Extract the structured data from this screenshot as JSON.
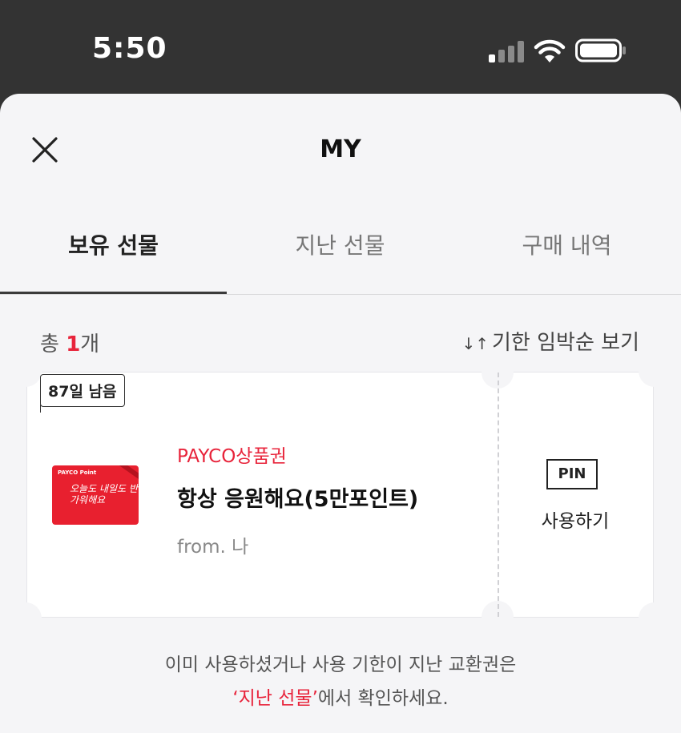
{
  "status_bar": {
    "time": "5:50",
    "icons": [
      "cellular-signal-icon",
      "wifi-icon",
      "battery-icon"
    ]
  },
  "header": {
    "title": "MY",
    "close_icon": "close-icon"
  },
  "tabs": [
    {
      "label": "보유 선물",
      "active": true
    },
    {
      "label": "지난 선물",
      "active": false
    },
    {
      "label": "구매 내역",
      "active": false
    }
  ],
  "summary": {
    "prefix": "총",
    "count": "1",
    "suffix": "개",
    "sort_icon": "sort-arrows-icon",
    "sort_label": "기한 임박순 보기"
  },
  "gift": {
    "days_left": "87일 남음",
    "thumb_brand": "PAYCO Point",
    "thumb_script": "오늘도 내일도 반가워해요",
    "brand": "PAYCO상품권",
    "name": "항상 응원해요(5만포인트)",
    "from": "from. 나",
    "pin_badge": "PIN",
    "use_label": "사용하기"
  },
  "footer": {
    "line1": "이미 사용하셨거나 사용 기한이 지난 교환권은",
    "link": "‘지난 선물’",
    "line2_suffix": "에서 확인하세요."
  },
  "colors": {
    "accent": "#e8243b",
    "status_bar_bg": "#333333",
    "sheet_bg": "#f5f5f7"
  }
}
